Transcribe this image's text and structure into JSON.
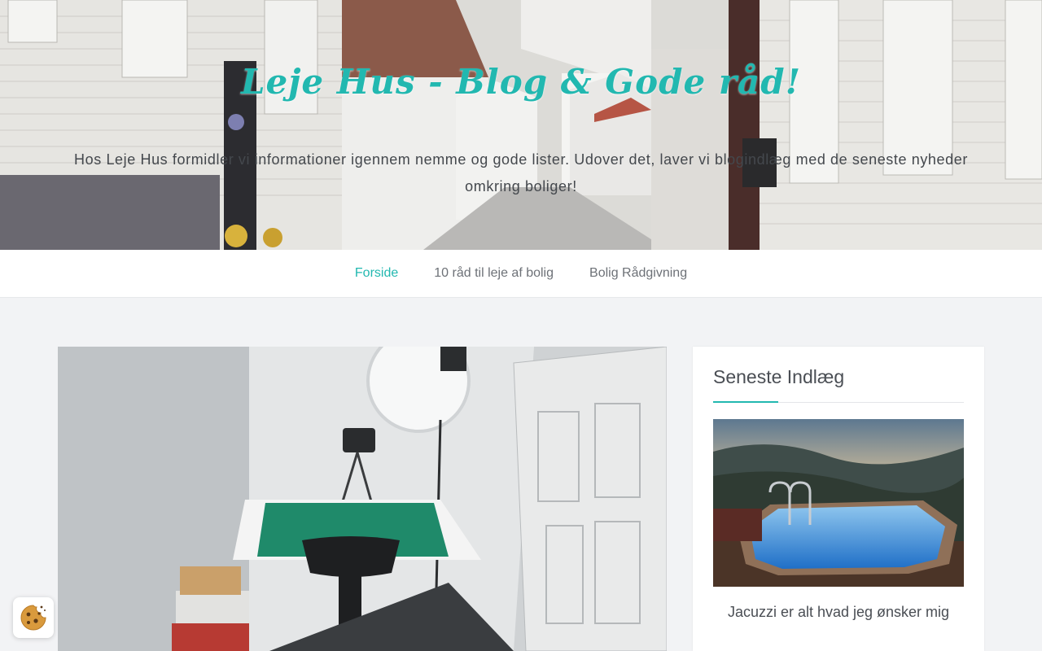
{
  "header": {
    "site_title": "Leje Hus - Blog & Gode råd!",
    "tagline": "Hos Leje Hus formidler vi informationer igennem nemme og gode lister. Udover det, laver vi blogindlæg med de seneste nyheder omkring boliger!"
  },
  "nav": {
    "items": [
      {
        "label": "Forside",
        "active": true
      },
      {
        "label": "10 råd til leje af bolig",
        "active": false
      },
      {
        "label": "Bolig Rådgivning",
        "active": false
      }
    ]
  },
  "sidebar": {
    "widget_title": "Seneste Indlæg",
    "latest_post": {
      "title": "Jacuzzi er alt hvad jeg ønsker mig"
    }
  },
  "icons": {
    "cookie": "cookie-icon"
  },
  "colors": {
    "accent": "#22b8b0",
    "text": "#4a4e54",
    "background": "#f2f3f5"
  }
}
